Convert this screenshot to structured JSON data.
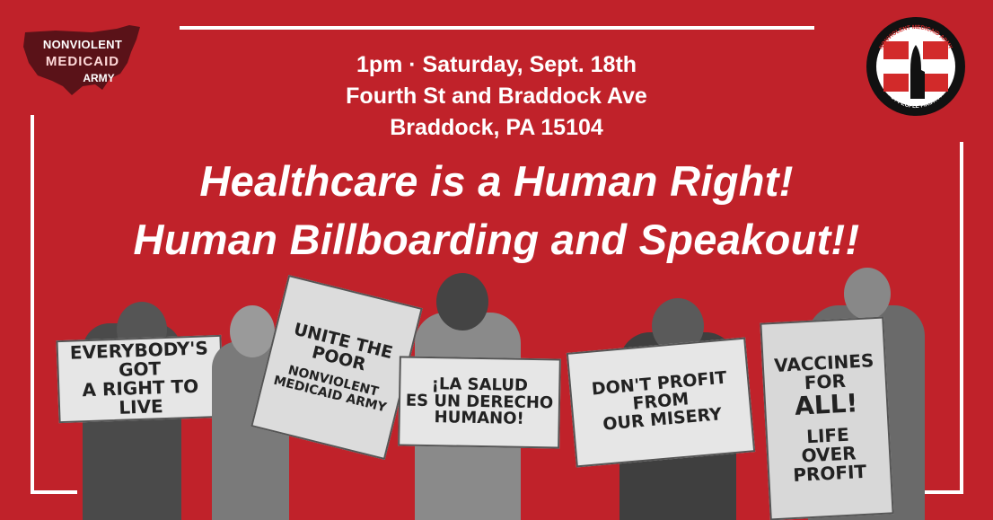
{
  "event": {
    "time": "1pm · Saturday, Sept. 18th",
    "street": "Fourth St and Braddock Ave",
    "city": "Braddock, PA 15104"
  },
  "headline": {
    "line1": "Healthcare is a Human Right!",
    "line2": "Human Billboarding and Speakout!!"
  },
  "logo_left": {
    "line1": "NONVIOLENT",
    "line2": "MEDICAID",
    "line3": "ARMY"
  },
  "logo_right": {
    "arc_top": "NONVIOLENT MEDICAID ARMY",
    "arc_bottom": "PUT PEOPLE FIRST! PA"
  },
  "signs": {
    "s1": [
      "EVERYBODY'S GOT",
      "A RIGHT TO LIVE"
    ],
    "s2": [
      "UNITE THE",
      "POOR",
      "NONVIOLENT",
      "MEDICAID ARMY"
    ],
    "s3": [
      "¡LA SALUD",
      "ES UN DERECHO",
      "HUMANO!"
    ],
    "s4": [
      "DON'T PROFIT",
      "FROM",
      "OUR MISERY"
    ],
    "s5": [
      "VACCINES",
      "FOR",
      "ALL!",
      "LIFE",
      "OVER",
      "PROFIT"
    ]
  },
  "colors": {
    "background": "#c0222a",
    "text": "#ffffff",
    "map": "#5a1218"
  }
}
